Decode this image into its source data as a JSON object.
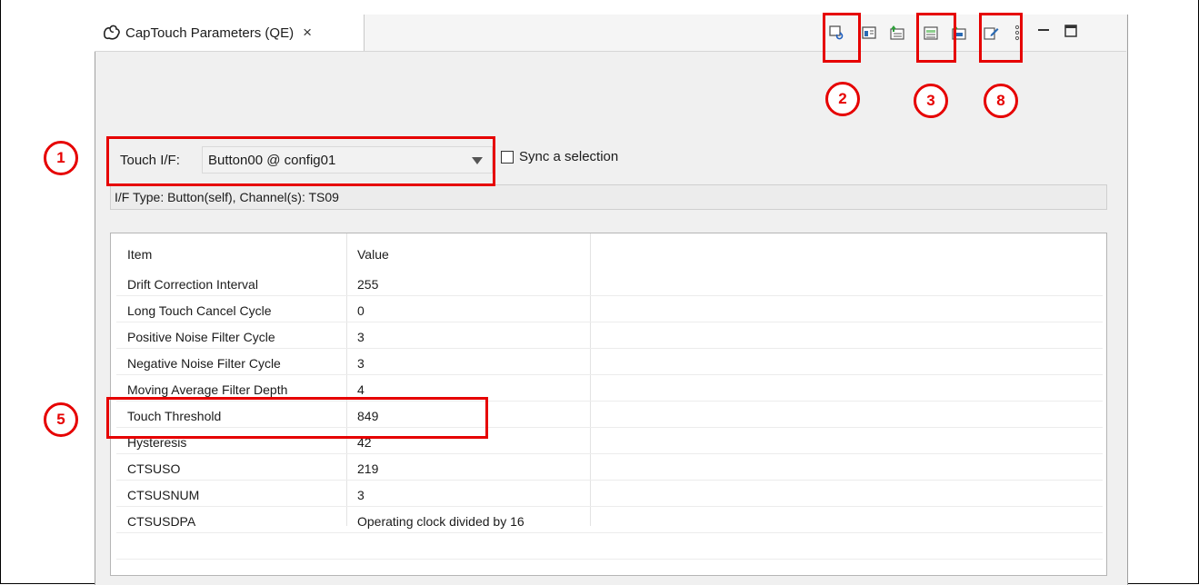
{
  "tab": {
    "title": "CapTouch Parameters (QE)",
    "close": "×"
  },
  "toolbar_icons": [
    "refresh-icon",
    "panel-view-icon",
    "import-icon",
    "export-icon",
    "compare-icon",
    "edit-icon",
    "more-icon",
    "minimize-icon",
    "maximize-icon"
  ],
  "touch_if": {
    "label": "Touch I/F:",
    "value": "Button00 @ config01"
  },
  "sync": {
    "label": "Sync a selection",
    "checked": false
  },
  "if_type": "I/F Type: Button(self), Channel(s): TS09",
  "table": {
    "headers": [
      "Item",
      "Value"
    ],
    "rows": [
      [
        "Drift Correction Interval",
        "255"
      ],
      [
        "Long Touch Cancel Cycle",
        "0"
      ],
      [
        "Positive Noise Filter Cycle",
        "3"
      ],
      [
        "Negative Noise Filter Cycle",
        "3"
      ],
      [
        "Moving Average Filter Depth",
        "4"
      ],
      [
        "Touch Threshold",
        "849"
      ],
      [
        "Hysteresis",
        "42"
      ],
      [
        "CTSUSO",
        "219"
      ],
      [
        "CTSUSNUM",
        "3"
      ],
      [
        "CTSUSDPA",
        "Operating clock divided by 16"
      ]
    ]
  },
  "annotations": {
    "n1": "1",
    "n2": "2",
    "n3": "3",
    "n5": "5",
    "n8": "8",
    "color": "#e60000"
  }
}
